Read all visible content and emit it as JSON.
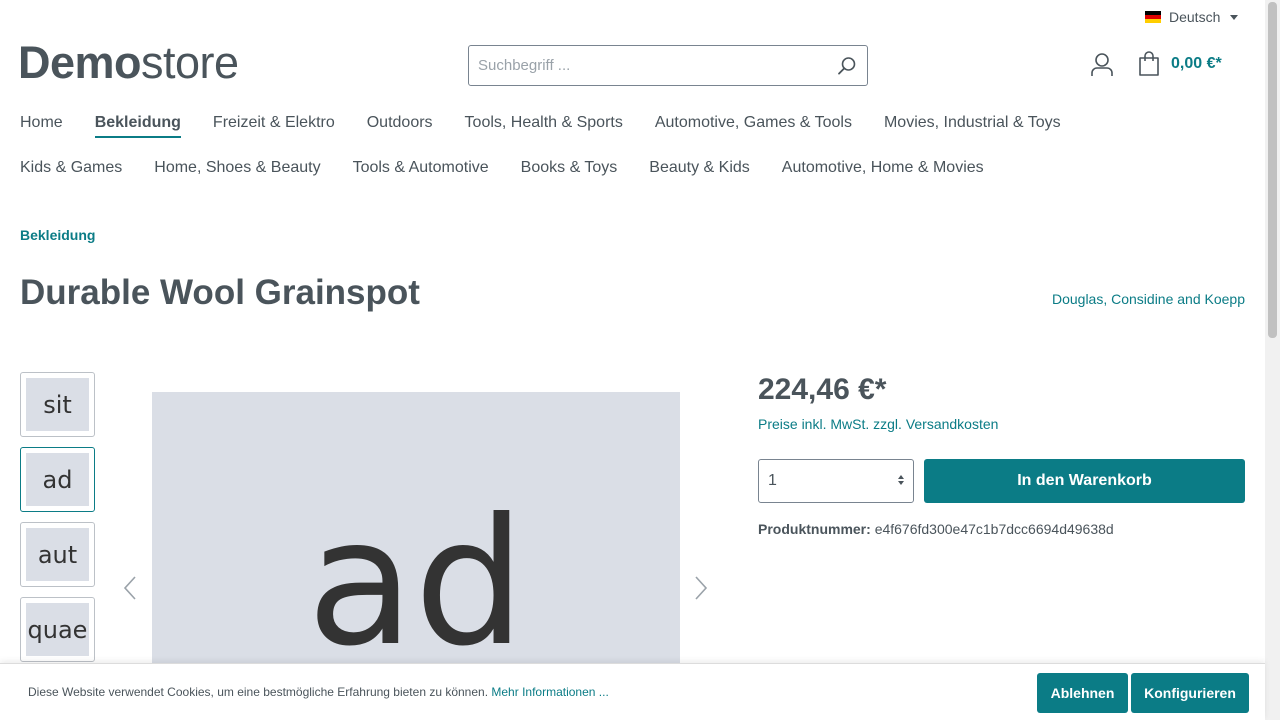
{
  "language": {
    "label": "Deutsch",
    "flag_colors": [
      "#000000",
      "#dd0000",
      "#ffce00"
    ]
  },
  "logo": {
    "bold": "Demo",
    "light": "store"
  },
  "search": {
    "placeholder": "Suchbegriff ..."
  },
  "header": {
    "cart_total": "0,00 €*"
  },
  "nav": {
    "row1": [
      "Home",
      "Bekleidung",
      "Freizeit & Elektro",
      "Outdoors",
      "Tools, Health & Sports",
      "Automotive, Games & Tools",
      "Movies, Industrial & Toys"
    ],
    "row2": [
      "Kids & Games",
      "Home, Shoes & Beauty",
      "Tools & Automotive",
      "Books & Toys",
      "Beauty & Kids",
      "Automotive, Home & Movies"
    ],
    "active": "Bekleidung"
  },
  "breadcrumb": "Bekleidung",
  "product": {
    "title": "Durable Wool Grainspot",
    "manufacturer": "Douglas, Considine and Koepp",
    "thumbnails": [
      "sit",
      "ad",
      "aut",
      "quae"
    ],
    "active_thumbnail": "ad",
    "main_image_text": "ad",
    "price": "224,46 €*",
    "tax_note": "Preise inkl. MwSt. zzgl. Versandkosten",
    "quantity": "1",
    "buy_label": "In den Warenkorb",
    "number_label": "Produktnummer:",
    "number_value": "e4f676fd300e47c1b7dcc6694d49638d"
  },
  "cookie": {
    "text": "Diese Website verwendet Cookies, um eine bestmögliche Erfahrung bieten zu können.",
    "link": "Mehr Informationen ...",
    "decline": "Ablehnen",
    "configure": "Konfigurieren"
  },
  "colors": {
    "accent": "#0b7c86",
    "text": "#4a545b",
    "image_bg": "#dadee6"
  }
}
